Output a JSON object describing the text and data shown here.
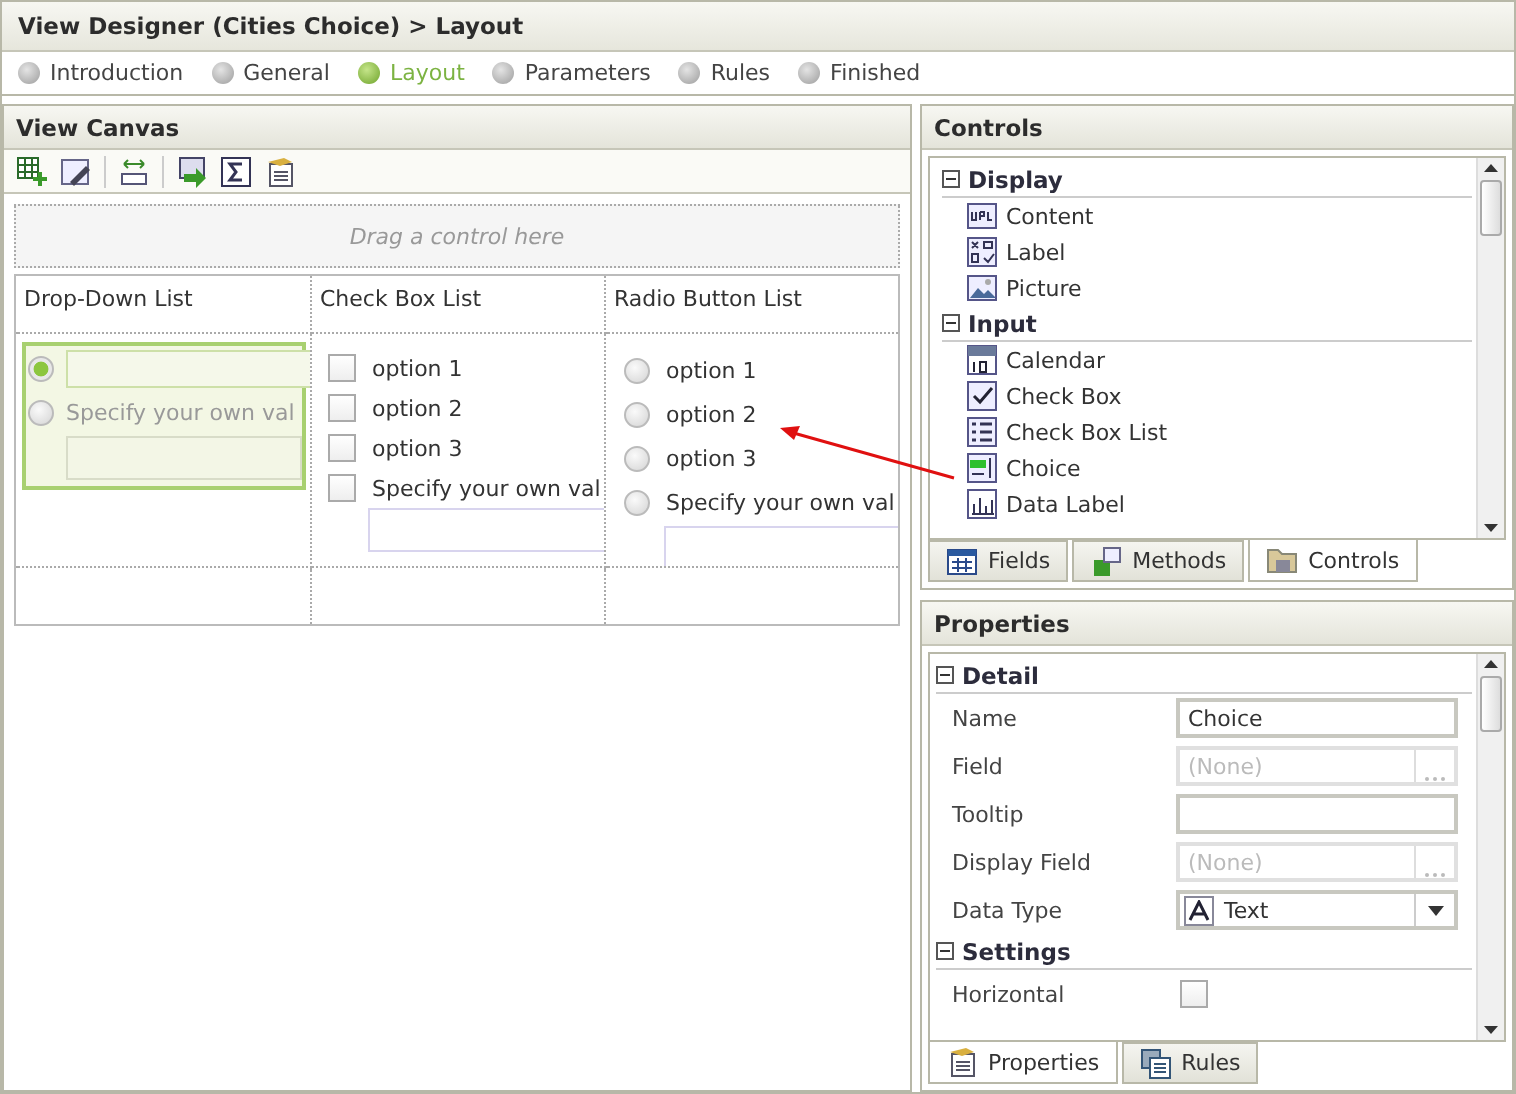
{
  "header": {
    "title": "View Designer (Cities Choice) > Layout"
  },
  "steps": [
    {
      "label": "Introduction",
      "selected": false
    },
    {
      "label": "General",
      "selected": false
    },
    {
      "label": "Layout",
      "selected": true
    },
    {
      "label": "Parameters",
      "selected": false
    },
    {
      "label": "Rules",
      "selected": false
    },
    {
      "label": "Finished",
      "selected": false
    }
  ],
  "canvas": {
    "title": "View Canvas",
    "drop_zone": "Drag a control here",
    "columns": [
      {
        "heading": "Drop-Down List",
        "kind": "choice",
        "selected": true,
        "items": [
          {
            "checked": true
          },
          {
            "checked": false,
            "label": "Specify your own val"
          }
        ]
      },
      {
        "heading": "Check Box List",
        "kind": "checkbox",
        "selected": false,
        "items": [
          {
            "checked": false,
            "label": "option 1"
          },
          {
            "checked": false,
            "label": "option 2"
          },
          {
            "checked": false,
            "label": "option 3"
          },
          {
            "checked": false,
            "label": "Specify your own val"
          }
        ]
      },
      {
        "heading": "Radio Button List",
        "kind": "radio",
        "selected": false,
        "items": [
          {
            "checked": false,
            "label": "option 1"
          },
          {
            "checked": false,
            "label": "option 2"
          },
          {
            "checked": false,
            "label": "option 3"
          },
          {
            "checked": false,
            "label": "Specify your own val"
          }
        ]
      }
    ]
  },
  "controls": {
    "title": "Controls",
    "groups": [
      {
        "title": "Display",
        "expanded": true,
        "items": [
          {
            "label": "Content"
          },
          {
            "label": "Label"
          },
          {
            "label": "Picture"
          }
        ]
      },
      {
        "title": "Input",
        "expanded": true,
        "items": [
          {
            "label": "Calendar"
          },
          {
            "label": "Check Box"
          },
          {
            "label": "Check Box List"
          },
          {
            "label": "Choice"
          },
          {
            "label": "Data Label"
          }
        ]
      }
    ],
    "tabs": [
      {
        "label": "Fields",
        "selected": false
      },
      {
        "label": "Methods",
        "selected": false
      },
      {
        "label": "Controls",
        "selected": true
      }
    ]
  },
  "properties": {
    "title": "Properties",
    "groups": [
      {
        "title": "Detail",
        "expanded": true,
        "rows": [
          {
            "label": "Name",
            "kind": "text",
            "value": "Choice"
          },
          {
            "label": "Field",
            "kind": "picker",
            "placeholder": "(None)",
            "disabled": true
          },
          {
            "label": "Tooltip",
            "kind": "text"
          },
          {
            "label": "Display Field",
            "kind": "picker",
            "placeholder": "(None)",
            "disabled": true
          },
          {
            "label": "Data Type",
            "kind": "select",
            "value": "Text"
          }
        ]
      },
      {
        "title": "Settings",
        "expanded": true,
        "rows": [
          {
            "label": "Horizontal",
            "kind": "checkbox",
            "checked": false
          }
        ]
      }
    ],
    "tabs": [
      {
        "label": "Properties",
        "selected": true
      },
      {
        "label": "Rules",
        "selected": false
      }
    ]
  }
}
